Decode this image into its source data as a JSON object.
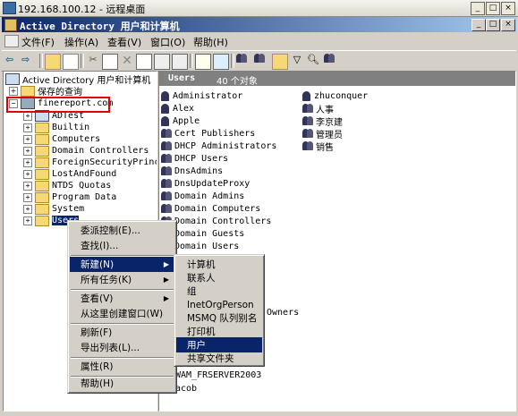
{
  "rdp_window": {
    "title": "192.168.100.12 - 远程桌面"
  },
  "app": {
    "title": "Active Directory 用户和计算机"
  },
  "menubar": [
    "文件(F)",
    "操作(A)",
    "查看(V)",
    "窗口(O)",
    "帮助(H)"
  ],
  "tree": {
    "root": "Active Directory 用户和计算机",
    "saved_queries": "保存的查询",
    "domain": "finereport.com",
    "children": [
      "ADTest",
      "Builtin",
      "Computers",
      "Domain Controllers",
      "ForeignSecurityPrincipa",
      "LostAndFound",
      "NTDS Quotas",
      "Program Data",
      "System",
      "Users"
    ]
  },
  "list_header": {
    "title": "Users",
    "count": "40 个对象"
  },
  "list_col1": [
    "Administrator",
    "Alex",
    "Apple",
    "Cert Publishers",
    "DHCP Administrators",
    "DHCP Users",
    "DnsAdmins",
    "DnsUpdateProxy",
    "Domain Admins",
    "Domain Computers",
    "Domain Controllers",
    "Domain Guests",
    "Domain Users"
  ],
  "list_col2": [
    "zhuconquer",
    "人事",
    "李京建",
    "管理员",
    "销售"
  ],
  "list_partial": [
    "Owners",
    "WAM_FRSERVER2003",
    "acob"
  ],
  "context_menu": {
    "items": [
      "委派控制(E)...",
      "查找(I)...",
      "新建(N)",
      "所有任务(K)",
      "查看(V)",
      "从这里创建窗口(W)",
      "刷新(F)",
      "导出列表(L)...",
      "属性(R)",
      "帮助(H)"
    ]
  },
  "new_submenu": {
    "items": [
      "计算机",
      "联系人",
      "组",
      "InetOrgPerson",
      "MSMQ 队列别名",
      "打印机",
      "用户",
      "共享文件夹"
    ],
    "selected": "用户"
  },
  "colors": {
    "title_blue": "#0a246a",
    "highlight": "#0a246a",
    "annotation_red": "#e00000"
  }
}
